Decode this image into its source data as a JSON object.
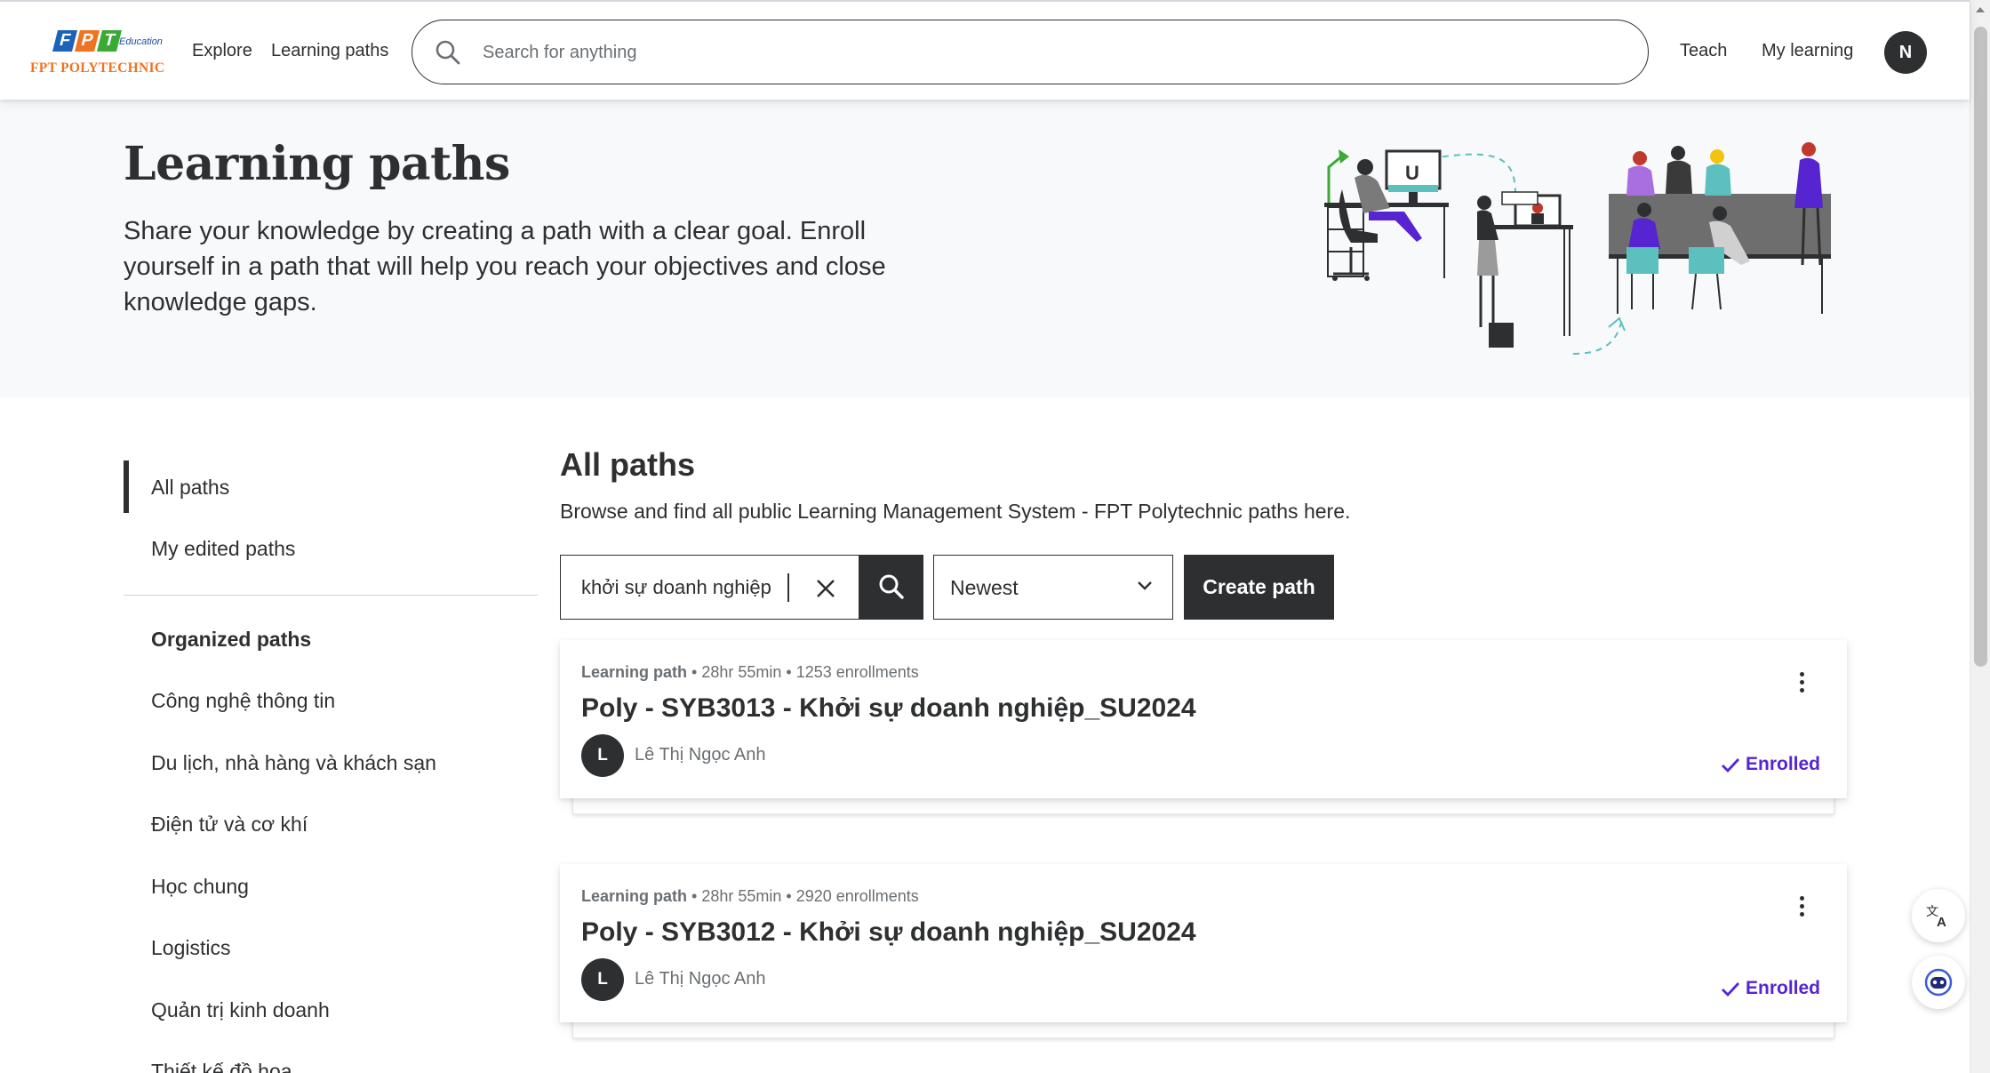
{
  "header": {
    "logo": {
      "top_letters": [
        "F",
        "P",
        "T"
      ],
      "edu_text": "Education",
      "brand_text": "FPT POLYTECHNIC"
    },
    "nav": {
      "explore": "Explore",
      "learning_paths": "Learning paths"
    },
    "search": {
      "placeholder": "Search for anything",
      "icon": "search-icon"
    },
    "right": {
      "teach": "Teach",
      "my_learning": "My learning",
      "avatar_initial": "N"
    }
  },
  "hero": {
    "title": "Learning paths",
    "description": "Share your knowledge by creating a path with a clear goal. Enroll yourself in a path that will help you reach your objectives and close knowledge gaps.",
    "screen_letter": "U"
  },
  "sidebar": {
    "items": [
      {
        "label": "All paths",
        "active": true
      },
      {
        "label": "My edited paths",
        "active": false
      }
    ],
    "organized_heading": "Organized paths",
    "organized": [
      "Công nghệ thông tin",
      "Du lịch, nhà hàng và khách sạn",
      "Điện tử và cơ khí",
      "Học chung",
      "Logistics",
      "Quản trị kinh doanh",
      "Thiết kế đồ họa"
    ]
  },
  "main": {
    "title": "All paths",
    "description": "Browse and find all public Learning Management System - FPT Polytechnic paths here.",
    "filter": {
      "query": "khởi sự doanh nghiệp",
      "sort_value": "Newest",
      "create_label": "Create path"
    },
    "cards": [
      {
        "type": "Learning path",
        "duration": "28hr 55min",
        "enrollments": "1253 enrollments",
        "title": "Poly - SYB3013 - Khởi sự doanh nghiệp_SU2024",
        "author_initial": "L",
        "author": "Lê Thị Ngọc Anh",
        "status": "Enrolled"
      },
      {
        "type": "Learning path",
        "duration": "28hr 55min",
        "enrollments": "2920 enrollments",
        "title": "Poly - SYB3012 - Khởi sự doanh nghiệp_SU2024",
        "author_initial": "L",
        "author": "Lê Thị Ngọc Anh",
        "status": "Enrolled"
      }
    ]
  },
  "floating": [
    "translate-icon",
    "assistant-icon"
  ],
  "colors": {
    "text": "#2d2f31",
    "muted": "#6a6f73",
    "accent": "#5624d0",
    "hero_bg": "#f7f9fa",
    "brand_orange": "#f0731f",
    "brand_blue": "#1a4fa0",
    "brand_green": "#3aaa35"
  }
}
